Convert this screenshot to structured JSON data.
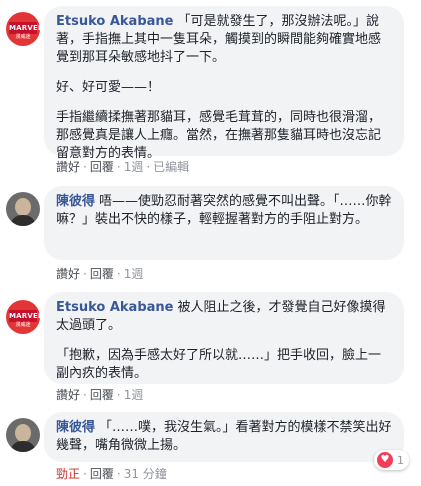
{
  "comments": [
    {
      "author": "Etsuko Akabane",
      "avatar_type": "marvel-logo",
      "avatar_text": "MARVEL",
      "avatar_sub": "漫威迷",
      "paragraphs": [
        "「可是就發生了，那沒辦法呢。」說著，手指撫上其中一隻耳朵，觸摸到的瞬間能夠確實地感覺到那耳朵敏感地抖了一下。",
        "好、好可愛——！",
        "手指繼續揉撫著那貓耳，感覺毛茸茸的，同時也很滑溜，那感覺真是讓人上癮。當然，在撫著那隻貓耳時也沒忘記留意對方的表情。"
      ],
      "actions": [
        "讚好",
        "回覆",
        "1週",
        "已編輯"
      ]
    },
    {
      "author": "陳彼得",
      "avatar_type": "photo",
      "paragraphs": [
        "唔——使勁忍耐著突然的感覺不叫出聲。「……你幹嘛？」裝出不快的樣子，輕輕握著對方的手阻止對方。"
      ],
      "actions": [
        "讚好",
        "回覆",
        "1週"
      ]
    },
    {
      "author": "Etsuko Akabane",
      "avatar_type": "marvel-logo",
      "avatar_text": "MARVEL",
      "avatar_sub": "漫威迷",
      "paragraphs": [
        "被人阻止之後，才發覺自己好像摸得太過頭了。",
        "「抱歉，因為手感太好了所以就……」把手收回，臉上一副內疚的表情。"
      ],
      "actions": [
        "讚好",
        "回覆",
        "1週"
      ]
    },
    {
      "author": "陳彼得",
      "avatar_type": "photo",
      "paragraphs": [
        "「……噗，我沒生氣。」看著對方的模樣不禁笑出好幾聲，嘴角微微上揚。"
      ],
      "actions": [
        "勁正",
        "回覆",
        "31 分鐘"
      ]
    }
  ],
  "reaction": {
    "icon": "heart-icon",
    "count": "1",
    "color": "#f33e58"
  },
  "colors": {
    "name": "#385898",
    "bubble": "#f2f3f5",
    "meta": "#90949c",
    "liked": "#c9302c"
  }
}
